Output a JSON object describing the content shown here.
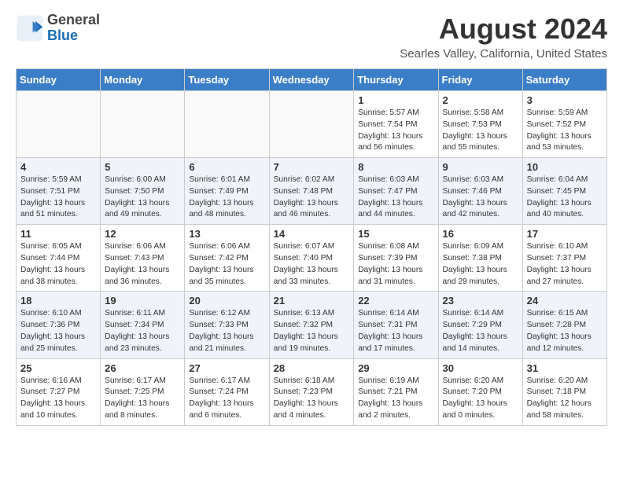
{
  "header": {
    "logo_general": "General",
    "logo_blue": "Blue",
    "title": "August 2024",
    "subtitle": "Searles Valley, California, United States"
  },
  "days_of_week": [
    "Sunday",
    "Monday",
    "Tuesday",
    "Wednesday",
    "Thursday",
    "Friday",
    "Saturday"
  ],
  "weeks": [
    [
      {
        "day": "",
        "info": ""
      },
      {
        "day": "",
        "info": ""
      },
      {
        "day": "",
        "info": ""
      },
      {
        "day": "",
        "info": ""
      },
      {
        "day": "1",
        "info": "Sunrise: 5:57 AM\nSunset: 7:54 PM\nDaylight: 13 hours and 56 minutes."
      },
      {
        "day": "2",
        "info": "Sunrise: 5:58 AM\nSunset: 7:53 PM\nDaylight: 13 hours and 55 minutes."
      },
      {
        "day": "3",
        "info": "Sunrise: 5:59 AM\nSunset: 7:52 PM\nDaylight: 13 hours and 53 minutes."
      }
    ],
    [
      {
        "day": "4",
        "info": "Sunrise: 5:59 AM\nSunset: 7:51 PM\nDaylight: 13 hours and 51 minutes."
      },
      {
        "day": "5",
        "info": "Sunrise: 6:00 AM\nSunset: 7:50 PM\nDaylight: 13 hours and 49 minutes."
      },
      {
        "day": "6",
        "info": "Sunrise: 6:01 AM\nSunset: 7:49 PM\nDaylight: 13 hours and 48 minutes."
      },
      {
        "day": "7",
        "info": "Sunrise: 6:02 AM\nSunset: 7:48 PM\nDaylight: 13 hours and 46 minutes."
      },
      {
        "day": "8",
        "info": "Sunrise: 6:03 AM\nSunset: 7:47 PM\nDaylight: 13 hours and 44 minutes."
      },
      {
        "day": "9",
        "info": "Sunrise: 6:03 AM\nSunset: 7:46 PM\nDaylight: 13 hours and 42 minutes."
      },
      {
        "day": "10",
        "info": "Sunrise: 6:04 AM\nSunset: 7:45 PM\nDaylight: 13 hours and 40 minutes."
      }
    ],
    [
      {
        "day": "11",
        "info": "Sunrise: 6:05 AM\nSunset: 7:44 PM\nDaylight: 13 hours and 38 minutes."
      },
      {
        "day": "12",
        "info": "Sunrise: 6:06 AM\nSunset: 7:43 PM\nDaylight: 13 hours and 36 minutes."
      },
      {
        "day": "13",
        "info": "Sunrise: 6:06 AM\nSunset: 7:42 PM\nDaylight: 13 hours and 35 minutes."
      },
      {
        "day": "14",
        "info": "Sunrise: 6:07 AM\nSunset: 7:40 PM\nDaylight: 13 hours and 33 minutes."
      },
      {
        "day": "15",
        "info": "Sunrise: 6:08 AM\nSunset: 7:39 PM\nDaylight: 13 hours and 31 minutes."
      },
      {
        "day": "16",
        "info": "Sunrise: 6:09 AM\nSunset: 7:38 PM\nDaylight: 13 hours and 29 minutes."
      },
      {
        "day": "17",
        "info": "Sunrise: 6:10 AM\nSunset: 7:37 PM\nDaylight: 13 hours and 27 minutes."
      }
    ],
    [
      {
        "day": "18",
        "info": "Sunrise: 6:10 AM\nSunset: 7:36 PM\nDaylight: 13 hours and 25 minutes."
      },
      {
        "day": "19",
        "info": "Sunrise: 6:11 AM\nSunset: 7:34 PM\nDaylight: 13 hours and 23 minutes."
      },
      {
        "day": "20",
        "info": "Sunrise: 6:12 AM\nSunset: 7:33 PM\nDaylight: 13 hours and 21 minutes."
      },
      {
        "day": "21",
        "info": "Sunrise: 6:13 AM\nSunset: 7:32 PM\nDaylight: 13 hours and 19 minutes."
      },
      {
        "day": "22",
        "info": "Sunrise: 6:14 AM\nSunset: 7:31 PM\nDaylight: 13 hours and 17 minutes."
      },
      {
        "day": "23",
        "info": "Sunrise: 6:14 AM\nSunset: 7:29 PM\nDaylight: 13 hours and 14 minutes."
      },
      {
        "day": "24",
        "info": "Sunrise: 6:15 AM\nSunset: 7:28 PM\nDaylight: 13 hours and 12 minutes."
      }
    ],
    [
      {
        "day": "25",
        "info": "Sunrise: 6:16 AM\nSunset: 7:27 PM\nDaylight: 13 hours and 10 minutes."
      },
      {
        "day": "26",
        "info": "Sunrise: 6:17 AM\nSunset: 7:25 PM\nDaylight: 13 hours and 8 minutes."
      },
      {
        "day": "27",
        "info": "Sunrise: 6:17 AM\nSunset: 7:24 PM\nDaylight: 13 hours and 6 minutes."
      },
      {
        "day": "28",
        "info": "Sunrise: 6:18 AM\nSunset: 7:23 PM\nDaylight: 13 hours and 4 minutes."
      },
      {
        "day": "29",
        "info": "Sunrise: 6:19 AM\nSunset: 7:21 PM\nDaylight: 13 hours and 2 minutes."
      },
      {
        "day": "30",
        "info": "Sunrise: 6:20 AM\nSunset: 7:20 PM\nDaylight: 13 hours and 0 minutes."
      },
      {
        "day": "31",
        "info": "Sunrise: 6:20 AM\nSunset: 7:18 PM\nDaylight: 12 hours and 58 minutes."
      }
    ]
  ]
}
